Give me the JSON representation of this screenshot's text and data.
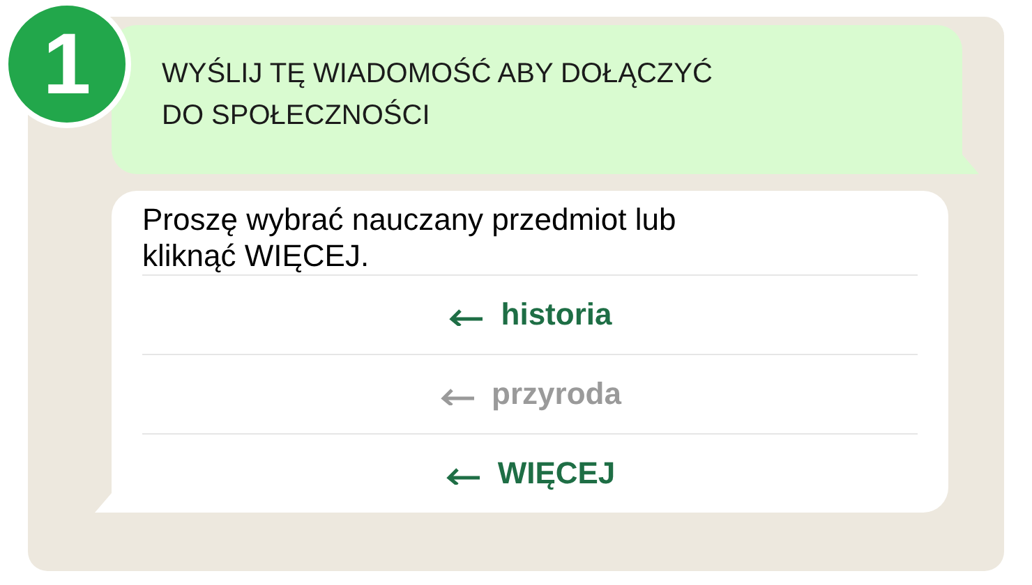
{
  "step": {
    "number": "1"
  },
  "instruction": "WYŚLIJ TĘ WIADOMOŚĆ ABY DOŁĄCZYĆ DO SPOŁECZNOŚCI",
  "message": {
    "text": "Proszę wybrać nauczany przedmiot lub kliknąć WIĘCEJ.",
    "replies": [
      {
        "label": "historia",
        "disabled": false
      },
      {
        "label": "przyroda",
        "disabled": true
      },
      {
        "label": "WIĘCEJ",
        "disabled": false
      }
    ]
  }
}
